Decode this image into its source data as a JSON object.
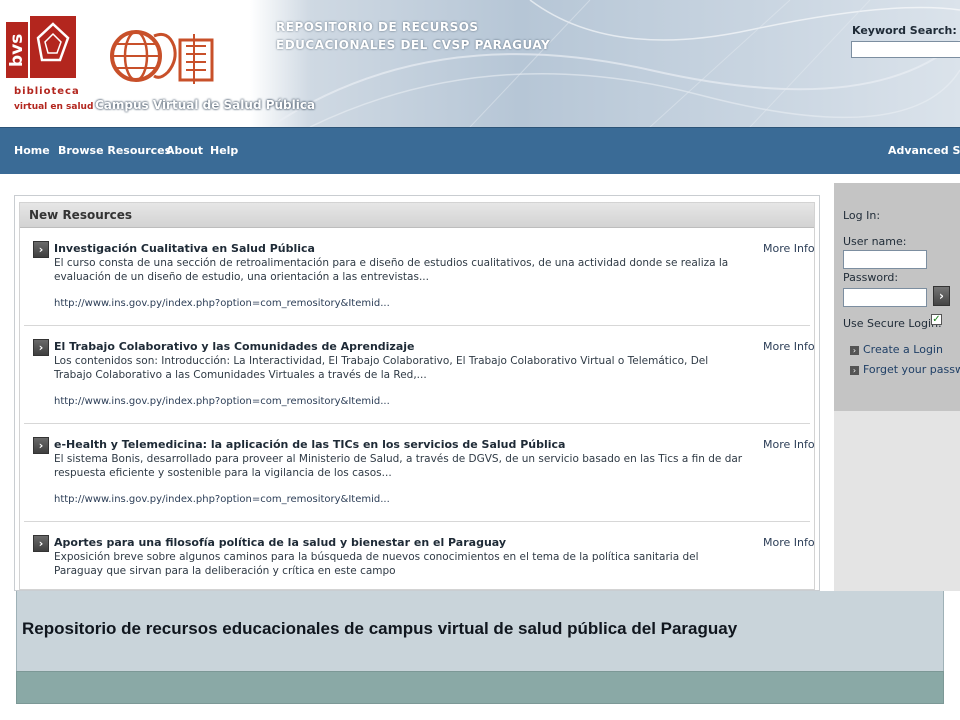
{
  "header": {
    "bvs_mark": "bvs",
    "bvs_word1": "biblioteca",
    "bvs_word2": "virtual en salud",
    "campus_name": "Campus Virtual de Salud Pública",
    "repo_title_line1": "REPOSITORIO DE RECURSOS",
    "repo_title_line2": "EDUCACIONALES DEL CVSP PARAGUAY",
    "keyword_label": "Keyword Search:",
    "keyword_value": ""
  },
  "nav": {
    "home": "Home",
    "browse": "Browse Resources",
    "about": "About",
    "help": "Help",
    "advanced": "Advanced Sea"
  },
  "main": {
    "section_title": "New Resources",
    "more_info_label": "More Info",
    "items": [
      {
        "title": "Investigación Cualitativa en Salud Pública",
        "desc": "El curso consta de una sección de retroalimentación para e diseño de estudios cualitativos, de una actividad donde se realiza la evaluación de un diseño de estudio, una orientación a las entrevistas...",
        "url": "http://www.ins.gov.py/index.php?option=com_remository&Itemid..."
      },
      {
        "title": "El Trabajo Colaborativo y las Comunidades de Aprendizaje",
        "desc": "Los contenidos son: Introducción: La Interactividad, El Trabajo Colaborativo, El Trabajo Colaborativo Virtual o Telemático, Del Trabajo Colaborativo a las Comunidades Virtuales a través de la Red,...",
        "url": "http://www.ins.gov.py/index.php?option=com_remository&Itemid..."
      },
      {
        "title": "e-Health y Telemedicina: la aplicación de las TICs en los servicios de Salud Pública",
        "desc": "El sistema Bonis, desarrollado para proveer al Ministerio de Salud, a través de DGVS, de un servicio basado en las Tics a fin de dar respuesta eficiente y sostenible para la vigilancia de los casos...",
        "url": "http://www.ins.gov.py/index.php?option=com_remository&Itemid..."
      },
      {
        "title": "Aportes para una filosofía política de la salud y bienestar en el Paraguay",
        "desc": "Exposición breve sobre algunos caminos para la búsqueda de nuevos conocimientos en el tema de la política sanitaria del Paraguay que sirvan para la deliberación y crítica en este campo",
        "url": ""
      }
    ]
  },
  "login": {
    "title": "Log In:",
    "username_label": "User name:",
    "password_label": "Password:",
    "secure_label": "Use Secure Login:",
    "secure_checked": true,
    "create_account": "Create a Login",
    "forgot_password": "Forget your password"
  },
  "caption": {
    "text": "Repositorio de recursos educacionales de campus virtual de salud pública del Paraguay"
  }
}
